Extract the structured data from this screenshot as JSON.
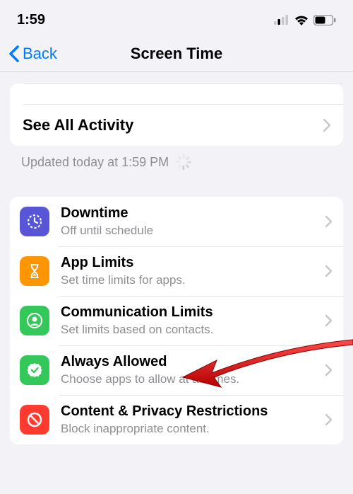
{
  "statusBar": {
    "time": "1:59"
  },
  "nav": {
    "back": "Back",
    "title": "Screen Time"
  },
  "activity": {
    "seeAll": "See All Activity",
    "updated": "Updated today at 1:59 PM"
  },
  "rows": [
    {
      "title": "Downtime",
      "sub": "Off until schedule"
    },
    {
      "title": "App Limits",
      "sub": "Set time limits for apps."
    },
    {
      "title": "Communication Limits",
      "sub": "Set limits based on contacts."
    },
    {
      "title": "Always Allowed",
      "sub": "Choose apps to allow at all times."
    },
    {
      "title": "Content & Privacy Restrictions",
      "sub": "Block inappropriate content."
    }
  ]
}
